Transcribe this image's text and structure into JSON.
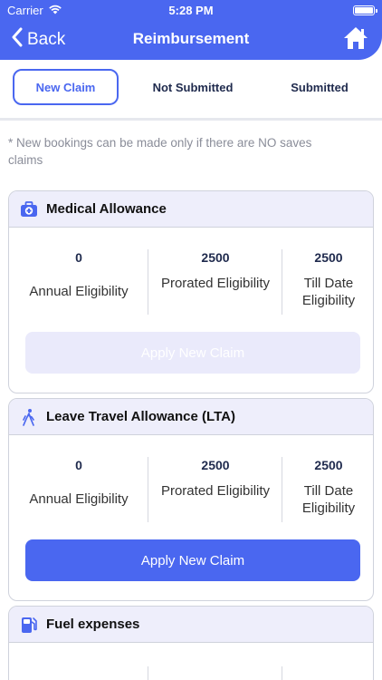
{
  "status_bar": {
    "carrier": "Carrier",
    "time": "5:28 PM"
  },
  "nav": {
    "back_label": "Back",
    "title": "Reimbursement"
  },
  "tabs": [
    {
      "label": "New Claim",
      "active": true
    },
    {
      "label": "Not Submitted",
      "active": false
    },
    {
      "label": "Submitted",
      "active": false
    }
  ],
  "note": "* New bookings can be made only if there are NO saves claims",
  "cards": [
    {
      "title": "Medical Allowance",
      "icon": "medical-kit-icon",
      "stats": [
        {
          "value": "0",
          "label": "Annual Eligibility"
        },
        {
          "value": "2500",
          "label": "Prorated Eligibility"
        },
        {
          "value": "2500",
          "label": "Till Date Eligibility"
        }
      ],
      "button": {
        "label": "Apply New Claim",
        "enabled": false
      }
    },
    {
      "title": "Leave Travel Allowance (LTA)",
      "icon": "traveler-icon",
      "stats": [
        {
          "value": "0",
          "label": "Annual Eligibility"
        },
        {
          "value": "2500",
          "label": "Prorated Eligibility"
        },
        {
          "value": "2500",
          "label": "Till Date Eligibility"
        }
      ],
      "button": {
        "label": "Apply New Claim",
        "enabled": true
      }
    },
    {
      "title": "Fuel expenses",
      "icon": "fuel-pump-icon"
    }
  ],
  "colors": {
    "accent": "#4a67f0",
    "card_header": "#eeeefb",
    "disabled_button": "#eaeafb"
  }
}
